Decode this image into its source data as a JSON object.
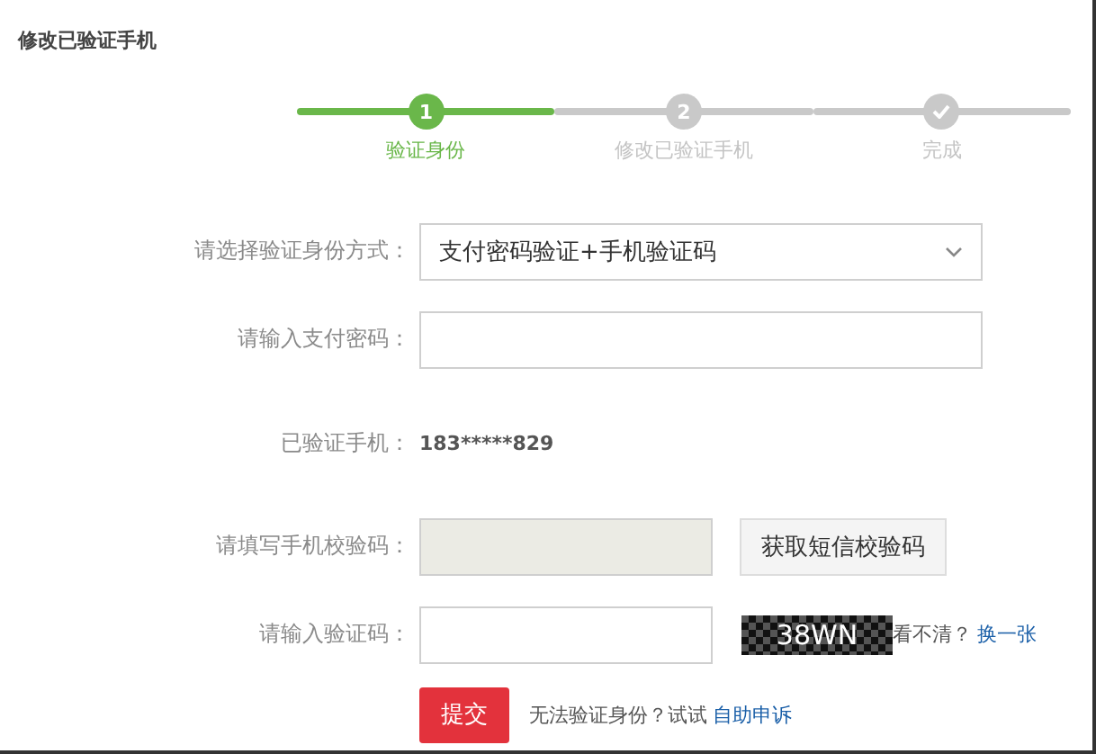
{
  "page_title": "修改已验证手机",
  "steps": [
    {
      "kind": "number",
      "number": "1",
      "label": "验证身份",
      "active": true
    },
    {
      "kind": "number",
      "number": "2",
      "label": "修改已验证手机",
      "active": false
    },
    {
      "kind": "check",
      "label": "完成",
      "active": false
    }
  ],
  "form": {
    "rows": [
      {
        "kind": "select",
        "label": "请选择验证身份方式：",
        "value": "支付密码验证+手机验证码"
      },
      {
        "kind": "input",
        "label": "请输入支付密码：",
        "disabled": false
      },
      {
        "kind": "text",
        "label": "已验证手机：",
        "value": "183*****829"
      },
      {
        "kind": "sms",
        "label": "请填写手机校验码：",
        "disabled": true,
        "button": "获取短信校验码"
      },
      {
        "kind": "captcha",
        "label": "请输入验证码：",
        "disabled": false,
        "captcha": "38WN",
        "hint": "看不清？",
        "link": "换一张"
      }
    ],
    "submit": "提交",
    "help_text": "无法验证身份？试试",
    "help_link": "自助申诉"
  }
}
